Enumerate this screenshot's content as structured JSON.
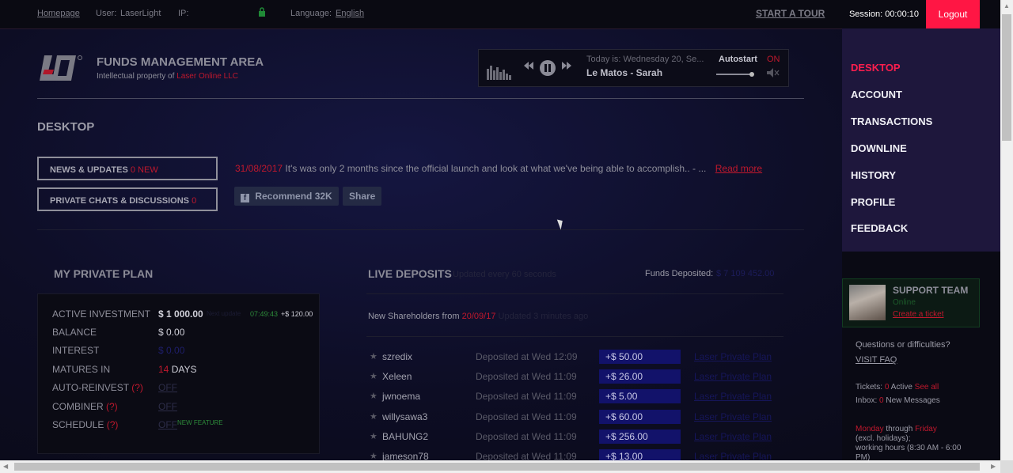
{
  "topbar": {
    "homepage": "Homepage",
    "user_label": "User:",
    "user_value": "LaserLight",
    "ip_label": "IP:",
    "language_label": "Language:",
    "language_value": "English",
    "start_tour": "START A TOUR",
    "session": "Session: 00:00:10",
    "logout": "Logout"
  },
  "header": {
    "title": "FUNDS MANAGEMENT AREA",
    "subtitle_prefix": "Intellectual property of",
    "subtitle_company": "Laser Online LLC"
  },
  "player": {
    "today": "Today is: Wednesday 20, Se...",
    "track": "Le Matos - Sarah",
    "autostart_label": "Autostart",
    "autostart_value": "ON",
    "volume": 0.9
  },
  "nav": {
    "items": [
      "DESKTOP",
      "ACCOUNT",
      "TRANSACTIONS",
      "DOWNLINE",
      "HISTORY",
      "PROFILE",
      "FEEDBACK"
    ],
    "active": "DESKTOP"
  },
  "desktop": {
    "title": "DESKTOP",
    "news_btn": "NEWS & UPDATES",
    "news_count": "0 NEW",
    "chats_btn": "PRIVATE CHATS & DISCUSSIONS",
    "chats_count": "0",
    "news_date": "31/08/2017",
    "news_text": "It's was only 2 months since the official launch and look at what we've being able to accomplish.. - ...",
    "read_more": "Read more",
    "recommend": "Recommend 32K",
    "share": "Share"
  },
  "plan": {
    "title": "MY PRIVATE PLAN",
    "rows": {
      "active_label": "ACTIVE INVESTMENT",
      "active_value": "$ 1 000.00",
      "active_next": "Next update",
      "active_time": "07:49:43",
      "active_gain": "+$ 120.00",
      "balance_label": "BALANCE",
      "balance_value": "$ 0.00",
      "interest_label": "INTEREST",
      "interest_value": "$ 0.00",
      "matures_label": "MATURES IN",
      "matures_num": "14",
      "matures_unit": "DAYS",
      "reinvest_label": "AUTO-REINVEST",
      "reinvest_value": "OFF",
      "combiner_label": "COMBINER",
      "combiner_value": "OFF",
      "schedule_label": "SCHEDULE",
      "schedule_value": "OFF",
      "new_feature": "NEW FEATURE",
      "help": "(?)"
    }
  },
  "live": {
    "title": "LIVE DEPOSITS",
    "subtitle": "Updated every 60 seconds",
    "funds_label": "Funds Deposited:",
    "funds_value": "$ 7 109 452.00",
    "new_share_prefix": "New Shareholders from",
    "new_share_date": "20/09/17",
    "new_share_suffix": "Updated 3 minutes ago",
    "deposits": [
      {
        "user": "szredix",
        "when": "Deposited at Wed 12:09",
        "amount": "+$ 50.00",
        "link": "Laser Private Plan"
      },
      {
        "user": "Xeleen",
        "when": "Deposited at Wed 11:09",
        "amount": "+$ 26.00",
        "link": "Laser Private Plan"
      },
      {
        "user": "jwnoema",
        "when": "Deposited at Wed 11:09",
        "amount": "+$ 5.00",
        "link": "Laser Private Plan"
      },
      {
        "user": "willysawa3",
        "when": "Deposited at Wed 11:09",
        "amount": "+$ 60.00",
        "link": "Laser Private Plan"
      },
      {
        "user": "BAHUNG2",
        "when": "Deposited at Wed 11:09",
        "amount": "+$ 256.00",
        "link": "Laser Private Plan"
      },
      {
        "user": "jameson78",
        "when": "Deposited at Wed 11:09",
        "amount": "+$ 13.00",
        "link": "Laser Private Plan"
      }
    ]
  },
  "support": {
    "title": "SUPPORT TEAM",
    "status": "Online",
    "ticket": "Create a ticket",
    "questions": "Questions or difficulties?",
    "faq": "VISIT FAQ",
    "tickets_label": "Tickets:",
    "tickets_count": "0",
    "tickets_active": "Active",
    "see_all": "See all",
    "inbox_label": "Inbox:",
    "inbox_count": "0",
    "inbox_msgs": "New Messages",
    "day_from": "Monday",
    "through": "through",
    "day_to": "Friday",
    "holidays": "(excl. holidays);",
    "hours": "working hours (8:30 AM - 6:00 PM)"
  },
  "colors": {
    "accent": "#ff1644",
    "nav_bg": "#1e173c",
    "deposit_bg": "#12126a"
  }
}
